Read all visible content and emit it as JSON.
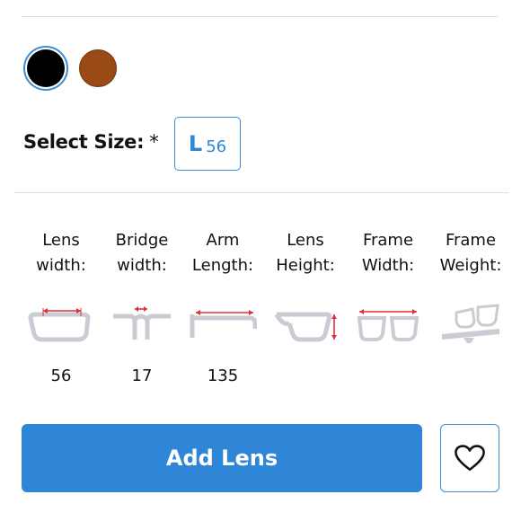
{
  "colors": {
    "accent": "#2f86d6",
    "swatches": [
      "#000000",
      "#9a4a14"
    ]
  },
  "size": {
    "label": "Select Size:",
    "required": "*",
    "option_letter": "L",
    "option_number": "56"
  },
  "measurements": [
    {
      "label": "Lens\nwidth:",
      "icon": "lens-width-icon",
      "value": "56"
    },
    {
      "label": "Bridge\nwidth:",
      "icon": "bridge-width-icon",
      "value": "17"
    },
    {
      "label": "Arm\nLength:",
      "icon": "arm-length-icon",
      "value": "135"
    },
    {
      "label": "Lens\nHeight:",
      "icon": "lens-height-icon",
      "value": ""
    },
    {
      "label": "Frame\nWidth:",
      "icon": "frame-width-icon",
      "value": ""
    },
    {
      "label": "Frame\nWeight:",
      "icon": "frame-weight-icon",
      "value": ""
    }
  ],
  "actions": {
    "add_lens": "Add Lens",
    "wishlist_icon": "heart-icon"
  }
}
